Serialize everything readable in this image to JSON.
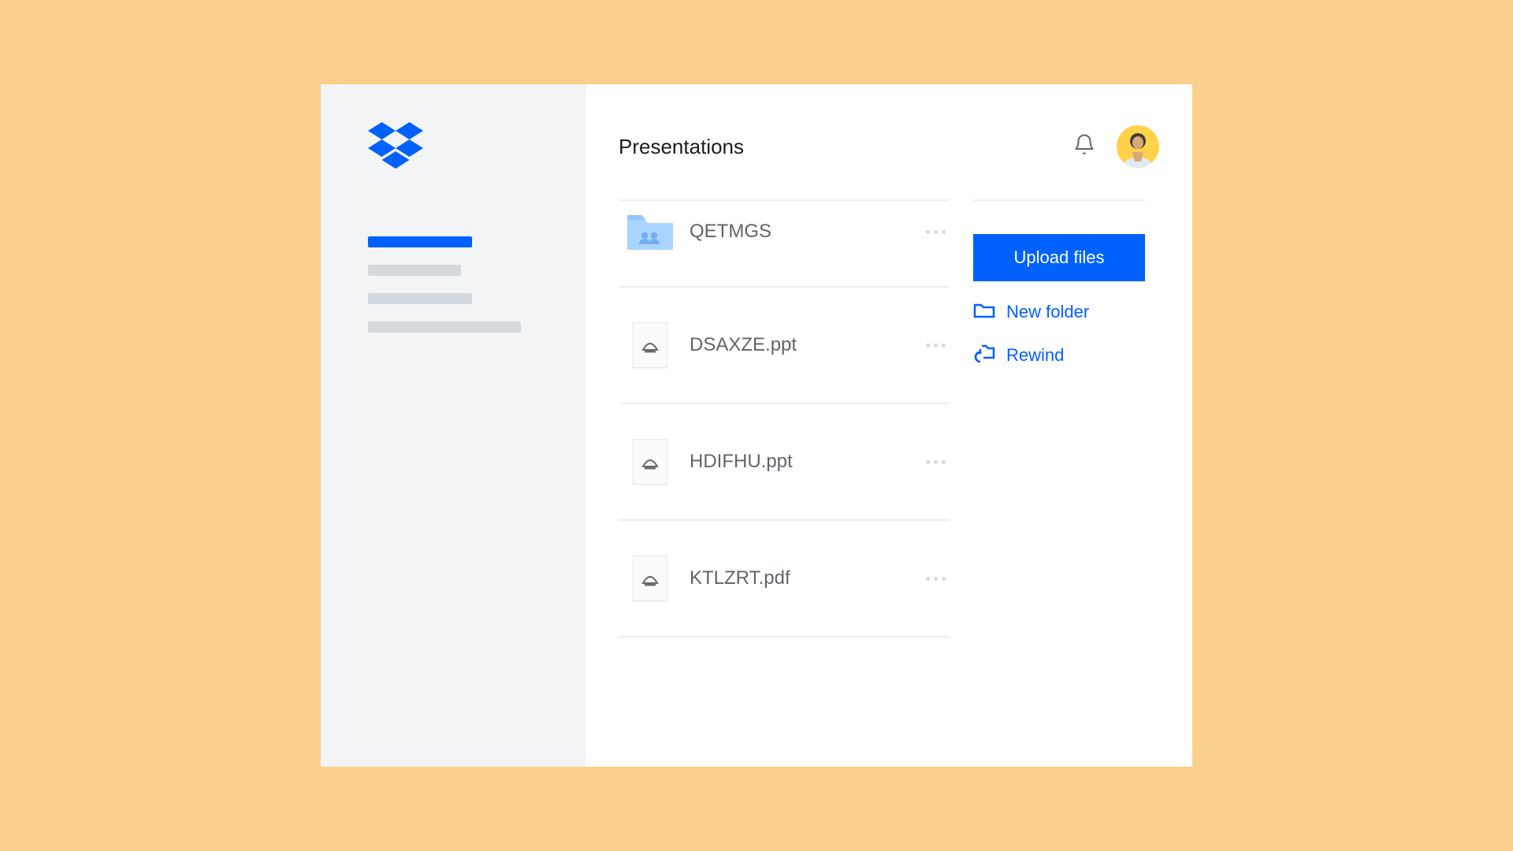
{
  "header": {
    "title": "Presentations"
  },
  "files": [
    {
      "name": "QETMGS",
      "type": "folder"
    },
    {
      "name": "DSAXZE.ppt",
      "type": "file"
    },
    {
      "name": "HDIFHU.ppt",
      "type": "file"
    },
    {
      "name": "KTLZRT.pdf",
      "type": "file"
    }
  ],
  "actions": {
    "upload_label": "Upload files",
    "new_folder_label": "New folder",
    "rewind_label": "Rewind"
  }
}
